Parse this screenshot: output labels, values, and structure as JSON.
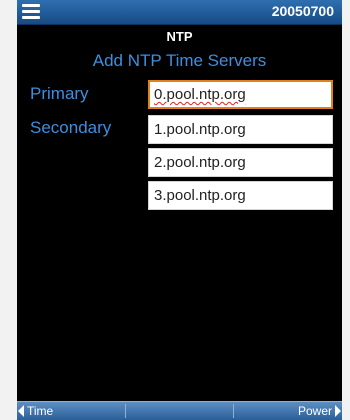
{
  "header": {
    "menu_icon": "hamburger-menu-icon",
    "device_id": "20050700"
  },
  "screen": {
    "title": "NTP",
    "subtitle": "Add NTP Time Servers"
  },
  "form": {
    "primary_label": "Primary",
    "secondary_label": "Secondary",
    "servers": [
      "0.pool.ntp.org",
      "1.pool.ntp.org",
      "2.pool.ntp.org",
      "3.pool.ntp.org"
    ]
  },
  "footer": {
    "left_label": "Time",
    "left_icon": "triangle-left-icon",
    "right_label": "Power",
    "right_icon": "triangle-right-icon"
  },
  "colors": {
    "topbar": "#1f5a99",
    "label_text": "#3c8fe0",
    "active_border": "#e2811c",
    "background": "#000000"
  }
}
